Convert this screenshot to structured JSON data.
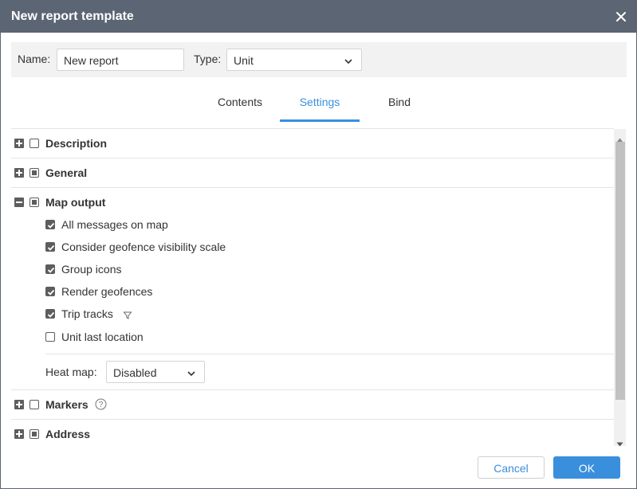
{
  "dialog": {
    "title": "New report template"
  },
  "form": {
    "name_label": "Name:",
    "name_value": "New report",
    "type_label": "Type:",
    "type_value": "Unit"
  },
  "tabs": [
    {
      "label": "Contents",
      "active": false
    },
    {
      "label": "Settings",
      "active": true
    },
    {
      "label": "Bind",
      "active": false
    }
  ],
  "sections": {
    "description": {
      "label": "Description",
      "expanded": false,
      "state": "unchecked"
    },
    "general": {
      "label": "General",
      "expanded": false,
      "state": "partial"
    },
    "map_output": {
      "label": "Map output",
      "expanded": true,
      "state": "partial",
      "items": [
        {
          "label": "All messages on map",
          "checked": true
        },
        {
          "label": "Consider geofence visibility scale",
          "checked": true
        },
        {
          "label": "Group icons",
          "checked": true
        },
        {
          "label": "Render geofences",
          "checked": true
        },
        {
          "label": "Trip tracks",
          "checked": true,
          "icon": "filter-icon"
        },
        {
          "label": "Unit last location",
          "checked": false
        }
      ],
      "heat_map_label": "Heat map:",
      "heat_map_value": "Disabled"
    },
    "markers": {
      "label": "Markers",
      "expanded": false,
      "state": "unchecked",
      "icon": "help-icon"
    },
    "address": {
      "label": "Address",
      "expanded": false,
      "state": "partial"
    }
  },
  "buttons": {
    "cancel": "Cancel",
    "ok": "OK"
  },
  "colors": {
    "titlebar": "#5c6573",
    "accent": "#3a8fdd",
    "checkbox": "#5d5d5d"
  }
}
